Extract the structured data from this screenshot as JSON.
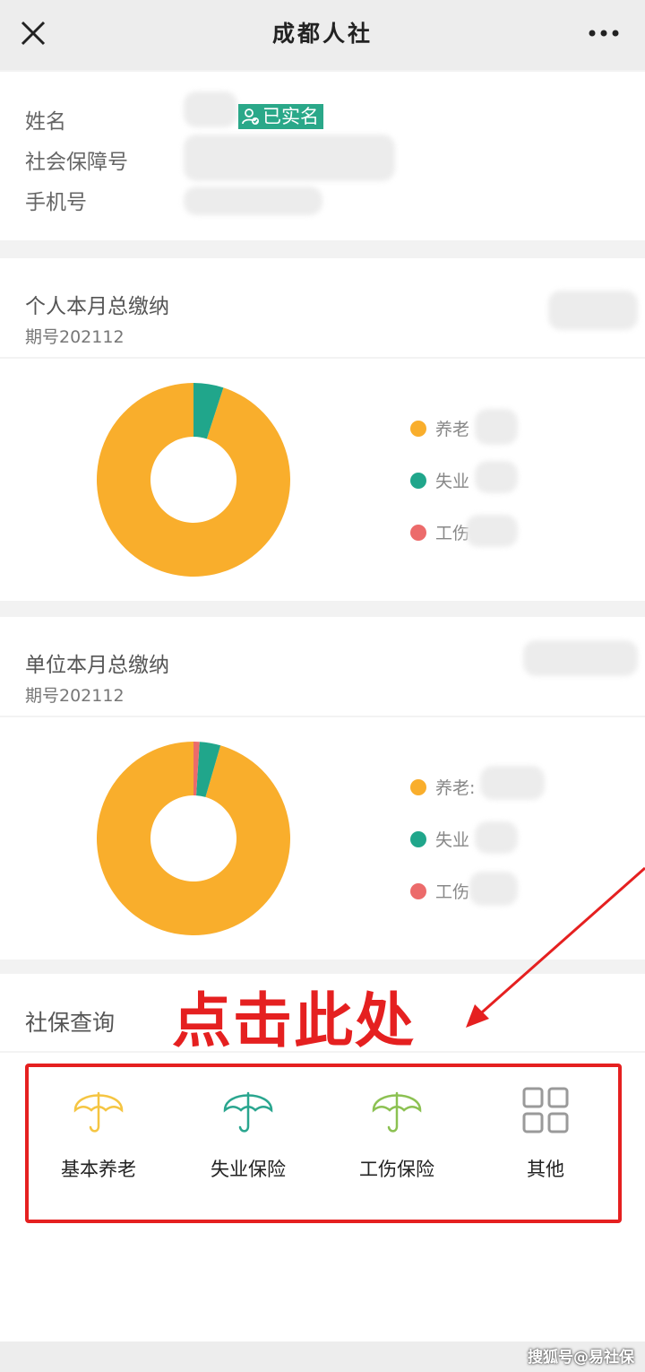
{
  "header": {
    "title": "成都人社"
  },
  "profile": {
    "name_label": "姓名",
    "ssn_label": "社会保障号",
    "phone_label": "手机号",
    "verified_badge": "已实名"
  },
  "personal": {
    "title": "个人本月总缴纳",
    "period": "期号202112",
    "legend": [
      "养老",
      "失业",
      "工伤"
    ]
  },
  "employer": {
    "title": "单位本月总缴纳",
    "period": "期号202112",
    "legend": [
      "养老:",
      "失业",
      "工伤"
    ]
  },
  "colors": {
    "pension": "#f9ae2c",
    "unemployment": "#20a68b",
    "injury": "#ec6b6b",
    "accent_red": "#e52020"
  },
  "chart_data": [
    {
      "type": "pie",
      "labels": [
        "养老",
        "失业",
        "工伤"
      ],
      "values": [
        0.95,
        0.05,
        0
      ]
    },
    {
      "type": "pie",
      "labels": [
        "养老:",
        "失业",
        "工伤"
      ],
      "values": [
        0.955,
        0.035,
        0.01
      ]
    }
  ],
  "query": {
    "title": "社保查询",
    "annotation": "点击此处",
    "services": [
      {
        "label": "基本养老",
        "icon": "umbrella-icon",
        "color": "#f5c542"
      },
      {
        "label": "失业保险",
        "icon": "umbrella-icon",
        "color": "#2aa68f"
      },
      {
        "label": "工伤保险",
        "icon": "umbrella-icon",
        "color": "#8cc152"
      },
      {
        "label": "其他",
        "icon": "grid-icon",
        "color": "#9a9a9a"
      }
    ]
  },
  "watermark": "搜狐号@易社保"
}
